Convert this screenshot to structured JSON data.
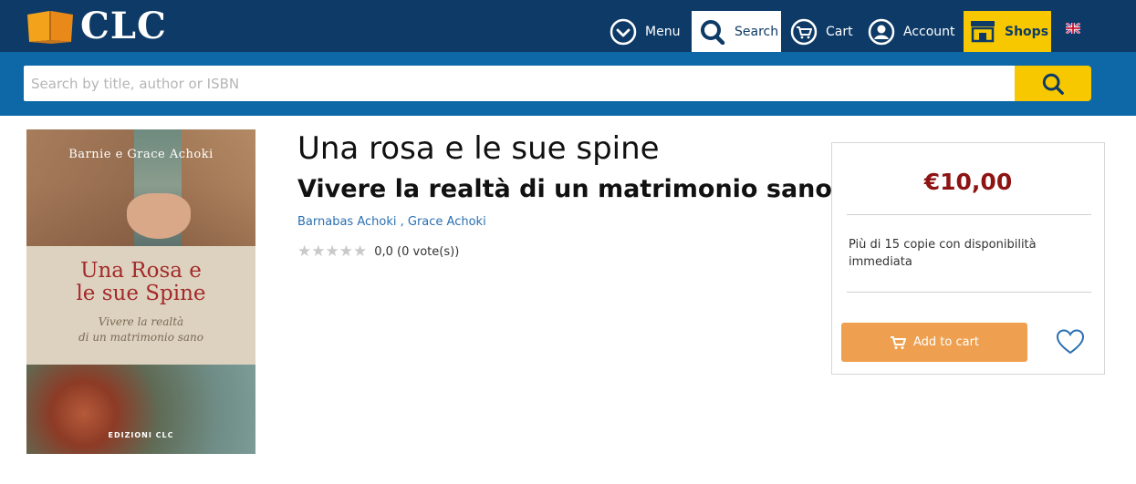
{
  "header": {
    "logo_text": "CLC",
    "nav": {
      "menu": "Menu",
      "search": "Search",
      "cart": "Cart",
      "account": "Account",
      "shops": "Shops"
    },
    "colors": {
      "background": "#0d3a66",
      "accent": "#f7c800"
    }
  },
  "search": {
    "placeholder": "Search by title, author or ISBN",
    "value": ""
  },
  "cover": {
    "authors": "Barnie e Grace Achoki",
    "title_line1": "Una Rosa e",
    "title_line2": "le sue Spine",
    "subtitle_line1": "Vivere la realtà",
    "subtitle_line2": "di un matrimonio sano",
    "publisher": "EDIZIONI CLC"
  },
  "product": {
    "title": "Una rosa e le sue spine",
    "subtitle": "Vivere la realtà di un matrimonio sano",
    "author1": "Barnabas Achoki",
    "author_sep": " , ",
    "author2": "Grace Achoki",
    "rating_text": "0,0 (0 vote(s))",
    "rating_stars": 0
  },
  "buybox": {
    "price": "€10,00",
    "availability": "Più di 15 copie con disponibilità immediata",
    "add_to_cart": "Add to cart",
    "price_color": "#8e1414",
    "button_color": "#eea050"
  }
}
